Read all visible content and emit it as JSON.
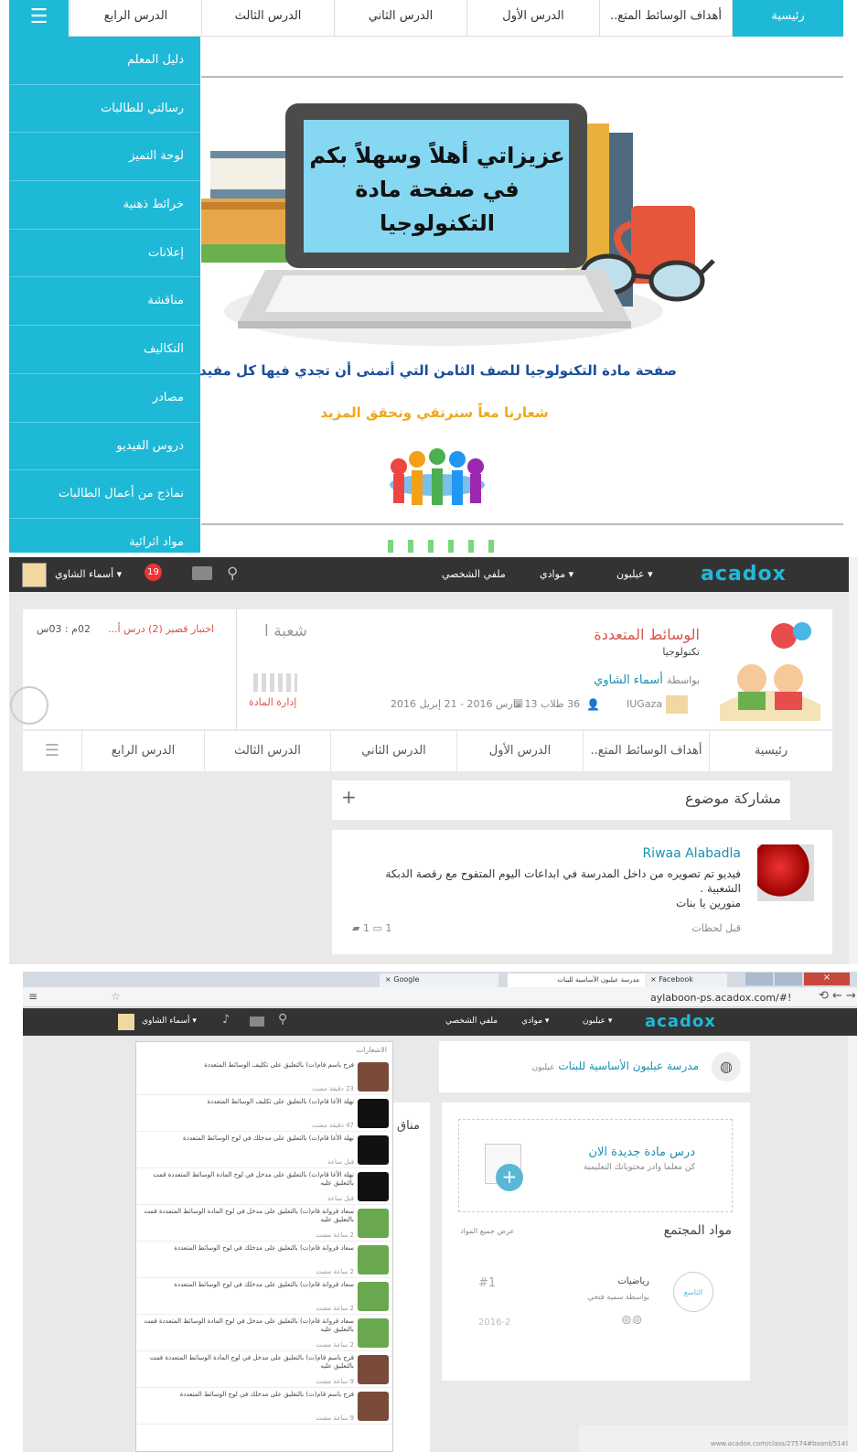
{
  "panel1": {
    "nav_tabs": [
      "رئيسية",
      "أهداف الوسائط المتع..",
      "الدرس الأول",
      "الدرس الثاني",
      "الدرس الثالث",
      "الدرس الرابع"
    ],
    "side_items": [
      "دليل المعلم",
      "رسالتي للطالبات",
      "لوحة التميز",
      "خرائط ذهنية",
      "إعلانات",
      "مناقشة",
      "التكاليف",
      "مصادر",
      "دروس الفيديو",
      "نماذج من أعمال الطالبات",
      "مواد اثرائية"
    ],
    "banner_text": [
      "عزيزاتي أهلاً وسهلاً بكم",
      "في صفحة مادة",
      "التكنولوجيا"
    ],
    "welcome_line": "صفحة مادة التكنولوجيا للصف الثامن التي أتمنى أن تجدي فيها كل مفيد",
    "slogan": "شعارنا معاً سنرتقي ونحقق المزيد"
  },
  "panel2": {
    "topbar": {
      "logo": "acadox",
      "menu1": "عيلبون",
      "menu2": "موادي",
      "menu3": "ملفي الشخصي",
      "user": "أسماء الشاوي",
      "badge": "19"
    },
    "course": {
      "title": "الوسائط المتعددة",
      "subject": "تكنولوجيا",
      "by_prefix": "بواسطة",
      "author": "أسماء الشاوي",
      "school": "IUGaza",
      "students": "36 طلاب",
      "dates": "13 مارس 2016 - 21 إبريل 2016",
      "section": "شعبة ا",
      "manage": "إدارة المادة",
      "quiz": "اختبار قصير (2) درس أ...",
      "time": "02م : 03س"
    },
    "tabs": [
      "رئيسية",
      "أهداف الوسائط المتع..",
      "الدرس الأول",
      "الدرس الثاني",
      "الدرس الثالث",
      "الدرس الرابع"
    ],
    "share": "مشاركة موضوع",
    "post": {
      "author": "Riwaa Alabadla",
      "text1": "فيديو تم تصويره من داخل المدرسة في ابداعات اليوم المتفوح مع رقصة الدبكة",
      "text2": "الشعبية .",
      "text3": "منورين يا بنات",
      "time": "قبل لحظات",
      "comments": "1",
      "likes": "1"
    }
  },
  "panel3": {
    "tabs": [
      "Facebook",
      "مدرسة عيلبون الأساسية للبنات",
      "Google"
    ],
    "url": "aylaboon-ps.acadox.com/#!",
    "topbar": {
      "logo": "acadox",
      "menu1": "عيلبون",
      "menu2": "موادي",
      "menu3": "ملفي الشخصي",
      "user": "أسماء الشاوي"
    },
    "school": "مدرسة عيلبون الأساسية للبنات",
    "school_loc": "عيلبون",
    "new_course": "درس مادة جديدة الان",
    "new_course_sub": "كن معلما وادر محتوياتك التعليمية",
    "community": "مواد المجتمع",
    "view_all": "عرض جميع المواد",
    "course": {
      "name": "رياضيات",
      "by": "بواسطة سمية فتحي",
      "rank": "#1",
      "date": "2016-2",
      "grade": "التاسع"
    },
    "partial": "مناق",
    "notif_header": "الاشعارات",
    "notifs": [
      {
        "text": "فرح باسم قام(ت) بالتعليق على تكليف الوسائط المتعددة",
        "time": "23 دقيقة مضت"
      },
      {
        "text": "نهلة الأغا قام(ت) بالتعليق على تكليف الوسائط المتعددة",
        "time": "47 دقيقة مضت"
      },
      {
        "text": "نهلة الأغا قام(ت) بالتعليق على مدخلك في لوح الوسائط المتعددة",
        "time": "قبل ساعة"
      },
      {
        "text": "نهلة الأغا قام(ت) بالتعليق على مدخل في لوح المادة الوسائط المتعددة قمت بالتعليق عليه",
        "time": "قبل ساعة"
      },
      {
        "text": "سعاد قروانة قام(ت) بالتعليق على مدخل في لوح المادة الوسائط المتعددة قمت بالتعليق عليه",
        "time": "2 ساعة مضت"
      },
      {
        "text": "سعاد قروانة قام(ت) بالتعليق على مدخلك في لوح الوسائط المتعددة",
        "time": "2 ساعة مضت"
      },
      {
        "text": "سعاد قروانة قام(ت) بالتعليق على مدخلك في لوح الوسائط المتعددة",
        "time": "2 ساعة مضت"
      },
      {
        "text": "سعاد قروانة قام(ت) بالتعليق على مدخل في لوح المادة الوسائط المتعددة قمت بالتعليق عليه",
        "time": "2 ساعة مضت"
      },
      {
        "text": "فرح باسم قام(ت) بالتعليق على مدخل في لوح المادة الوسائط المتعددة قمت بالتعليق عليه",
        "time": "9 ساعة مضت"
      },
      {
        "text": "فرح باسم قام(ت) بالتعليق على مدخلك في لوح الوسائط المتعددة",
        "time": "9 ساعة مضت"
      }
    ],
    "status_url": "www.acadox.com/class/27574#board/51498"
  }
}
